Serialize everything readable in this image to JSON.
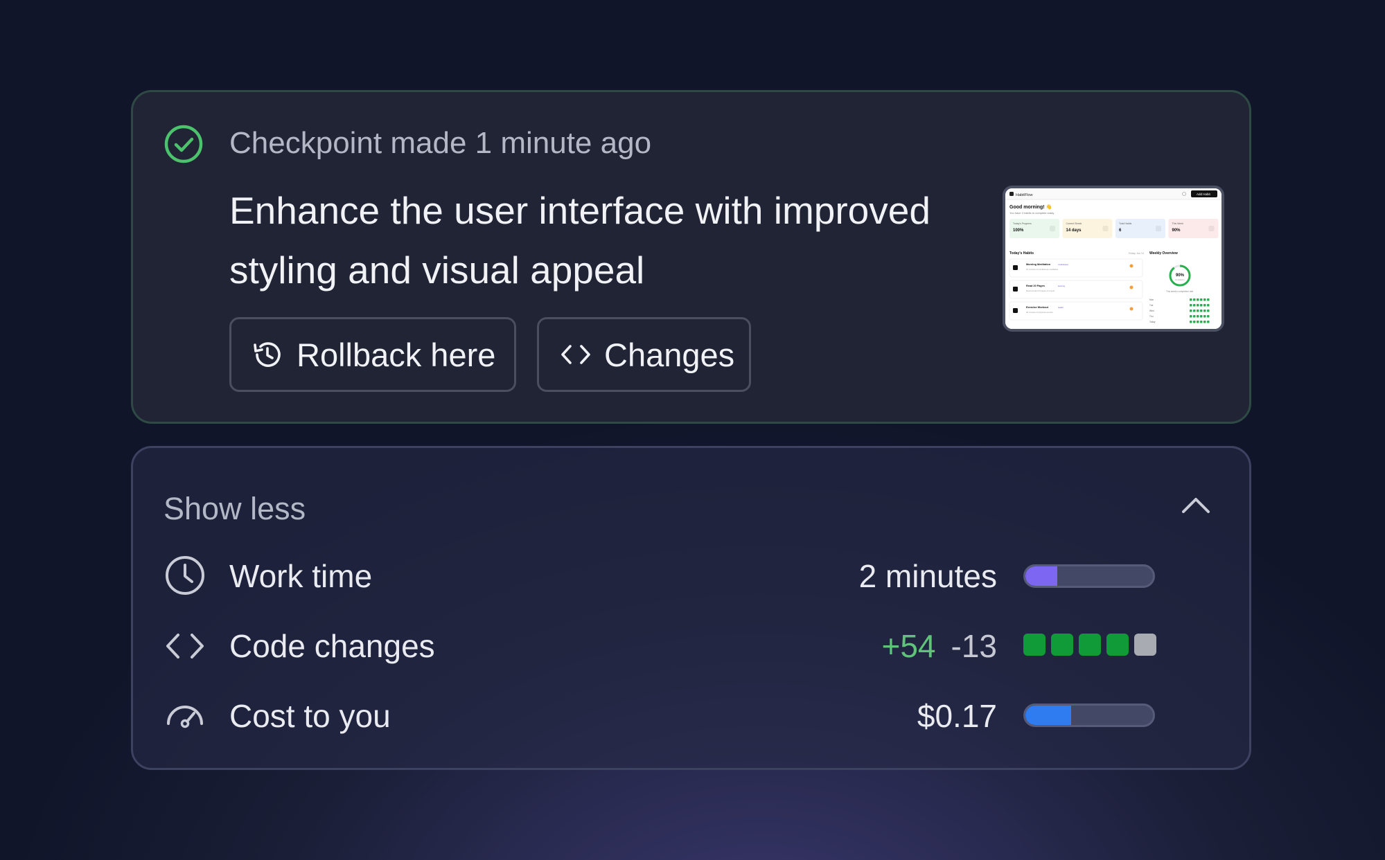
{
  "checkpoint": {
    "time_text": "Checkpoint made 1 minute ago",
    "title": "Enhance the user interface with improved styling and visual appeal",
    "rollback_label": "Rollback here",
    "changes_label": "Changes",
    "status_icon": "check-circle-icon",
    "thumbnail": {
      "app_name": "HabitFlow",
      "greeting": "Good morning! 👋",
      "subtitle": "You have 3 habits to complete today",
      "button": "Add Habit",
      "cards": [
        {
          "label": "Today's Progress",
          "value": "100%",
          "color": "#e9f7ec"
        },
        {
          "label": "Current Streak",
          "value": "14 days",
          "color": "#fdf4df"
        },
        {
          "label": "Total Habits",
          "value": "6",
          "color": "#e7f0fb"
        },
        {
          "label": "This Week",
          "value": "90%",
          "color": "#fce9ea"
        }
      ],
      "list_title": "Today's Habits",
      "list_date": "Friday, Jun 14",
      "habits": [
        {
          "name": "Morning Meditation",
          "tag": "mindfulness",
          "desc": "10 minutes of mindfulness meditation"
        },
        {
          "name": "Read 20 Pages",
          "tag": "learning",
          "desc": "Read at least 20 pages of a book"
        },
        {
          "name": "Exercise Workout",
          "tag": "health",
          "desc": "30 minutes of physical exercise"
        }
      ],
      "overview_title": "Weekly Overview",
      "ring_value": "90%",
      "ring_caption": "completion",
      "overview_caption": "This week's completion rate",
      "days": [
        "Mon",
        "Tue",
        "Wed",
        "Thu",
        "Today"
      ]
    }
  },
  "stats": {
    "toggle_label": "Show less",
    "work_time": {
      "label": "Work time",
      "value": "2 minutes",
      "fill_fraction": 0.25,
      "color": "#7c66f2"
    },
    "code_changes": {
      "label": "Code changes",
      "added": "+54",
      "removed": "-13",
      "blocks": [
        "#109a38",
        "#109a38",
        "#109a38",
        "#109a38",
        "#a9abb3"
      ]
    },
    "cost": {
      "label": "Cost to you",
      "value": "$0.17",
      "fill_fraction": 0.36,
      "color": "#2e7cf0"
    }
  }
}
